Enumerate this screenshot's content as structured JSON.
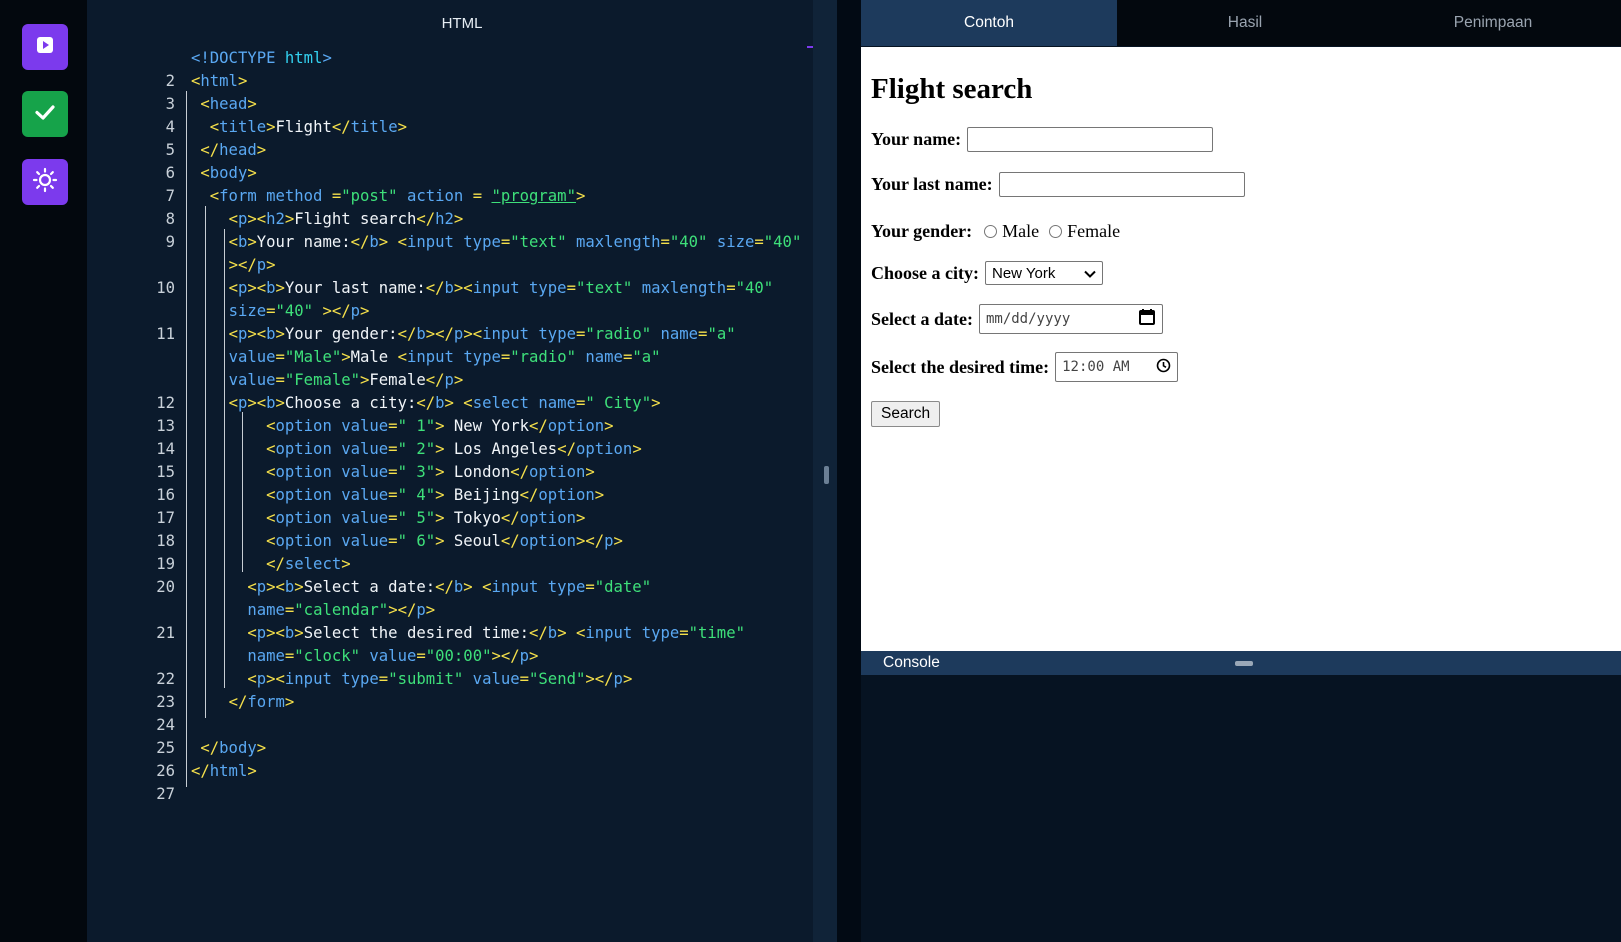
{
  "sidebar": {
    "run_icon": "play-icon",
    "check_icon": "check-icon",
    "theme_icon": "sun-icon",
    "colors": {
      "run": "#7c3aed",
      "check": "#16a34a",
      "theme": "#7c3aed"
    }
  },
  "editor": {
    "title": "HTML",
    "line_numbers": [
      "",
      "2",
      "3",
      "4",
      "5",
      "6",
      "7",
      "8",
      "9",
      "",
      "10",
      "",
      "11",
      "",
      "",
      "12",
      "13",
      "14",
      "15",
      "16",
      "17",
      "18",
      "19",
      "20",
      "",
      "21",
      "",
      "22",
      "23",
      "24",
      "25",
      "26",
      "27"
    ]
  },
  "tabs": [
    {
      "label": "Contoh",
      "active": true
    },
    {
      "label": "Hasil",
      "active": false
    },
    {
      "label": "Penimpaan",
      "active": false
    }
  ],
  "preview": {
    "heading": "Flight search",
    "name_label": "Your name:",
    "last_name_label": "Your last name:",
    "gender_label": "Your gender:",
    "gender_options": [
      "Male",
      "Female"
    ],
    "city_label": "Choose a city:",
    "city_selected": "New York",
    "date_label": "Select a date:",
    "date_placeholder": "mm/dd/yyyy",
    "time_label": "Select the desired time:",
    "time_value": "12:00 AM",
    "submit_label": "Search"
  },
  "console": {
    "label": "Console"
  }
}
